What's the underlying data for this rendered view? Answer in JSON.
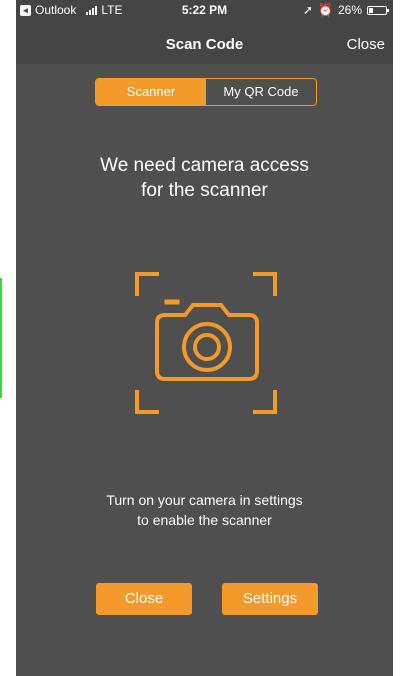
{
  "status_bar": {
    "back_app": "Outlook",
    "network": "LTE",
    "time": "5:22 PM",
    "battery_percent": "26%",
    "battery_level": 0.26
  },
  "nav": {
    "title": "Scan Code",
    "close_label": "Close"
  },
  "tabs": [
    {
      "label": "Scanner",
      "active": true
    },
    {
      "label": "My QR Code",
      "active": false
    }
  ],
  "main": {
    "heading_line1": "We need camera access",
    "heading_line2": "for the scanner",
    "camera_icon": "camera-frame-icon",
    "subtext_line1": "Turn on your camera in settings",
    "subtext_line2": "to enable the scanner"
  },
  "buttons": {
    "close_label": "Close",
    "settings_label": "Settings"
  },
  "colors": {
    "accent": "#f39a2a",
    "background": "#4f4f4f",
    "bar": "#454545"
  }
}
